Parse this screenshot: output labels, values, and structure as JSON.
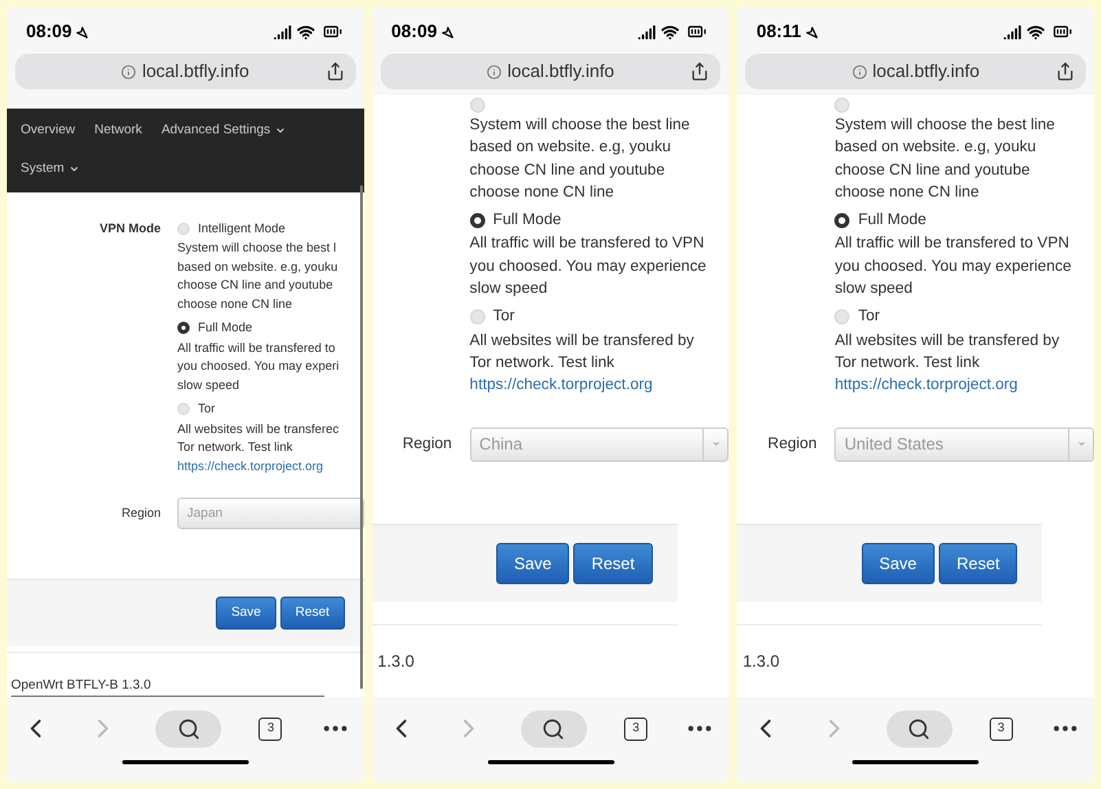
{
  "phones": [
    {
      "kind": "zoomed_out",
      "time": "08:09",
      "url": "local.btfly.info",
      "nav": [
        {
          "label": "Overview",
          "has_menu": false
        },
        {
          "label": "Network",
          "has_menu": false
        },
        {
          "label": "Advanced Settings",
          "has_menu": true
        },
        {
          "label": "System",
          "has_menu": true
        }
      ],
      "mode_label": "VPN Mode",
      "options": [
        {
          "label": "Intelligent Mode",
          "selected": false,
          "lines": [
            "System will choose the best l",
            "based on website. e.g, youku",
            "choose CN line and youtube",
            "choose none CN line"
          ]
        },
        {
          "label": "Full Mode",
          "selected": true,
          "lines": [
            "All traffic will be transfered to",
            "you choosed. You may experi",
            "slow speed"
          ]
        },
        {
          "label": "Tor",
          "selected": false,
          "lines": [
            "All websites will be transferec",
            "Tor network. Test link"
          ],
          "link": "https://check.torproject.org"
        }
      ],
      "region_label": "Region",
      "region_value": "Japan",
      "buttons": [
        "Save",
        "Reset"
      ],
      "footer": "OpenWrt BTFLY-B 1.3.0",
      "tab_count": "3",
      "back_enabled": true,
      "forward_enabled": false
    },
    {
      "kind": "zoomed_in",
      "time": "08:09",
      "url": "local.btfly.info",
      "options": [
        {
          "selected": false,
          "lines": [
            "System will choose the best line",
            "based on website. e.g, youku",
            "choose CN line and youtube",
            "choose none CN line"
          ]
        },
        {
          "label": "Full Mode",
          "selected": true,
          "lines": [
            "All traffic will be transfered to VPN",
            "you choosed. You may experience",
            "slow speed"
          ]
        },
        {
          "label": "Tor",
          "selected": false,
          "lines": [
            "All websites will be transfered by",
            "Tor network. Test link"
          ],
          "link": "https://check.torproject.org"
        }
      ],
      "region_label": "Region",
      "region_value": "China",
      "buttons": [
        "Save",
        "Reset"
      ],
      "footer": "1.3.0",
      "tab_count": "3",
      "back_enabled": true,
      "forward_enabled": false
    },
    {
      "kind": "zoomed_in",
      "time": "08:11",
      "url": "local.btfly.info",
      "options": [
        {
          "selected": false,
          "lines": [
            "System will choose the best line",
            "based on website. e.g, youku",
            "choose CN line and youtube",
            "choose none CN line"
          ]
        },
        {
          "label": "Full Mode",
          "selected": true,
          "lines": [
            "All traffic will be transfered to VPN",
            "you choosed. You may experience",
            "slow speed"
          ]
        },
        {
          "label": "Tor",
          "selected": false,
          "lines": [
            "All websites will be transfered by",
            "Tor network. Test link"
          ],
          "link": "https://check.torproject.org"
        }
      ],
      "region_label": "Region",
      "region_value": "United States",
      "buttons": [
        "Save",
        "Reset"
      ],
      "footer": "1.3.0",
      "tab_count": "3",
      "back_enabled": true,
      "forward_enabled": false
    }
  ]
}
